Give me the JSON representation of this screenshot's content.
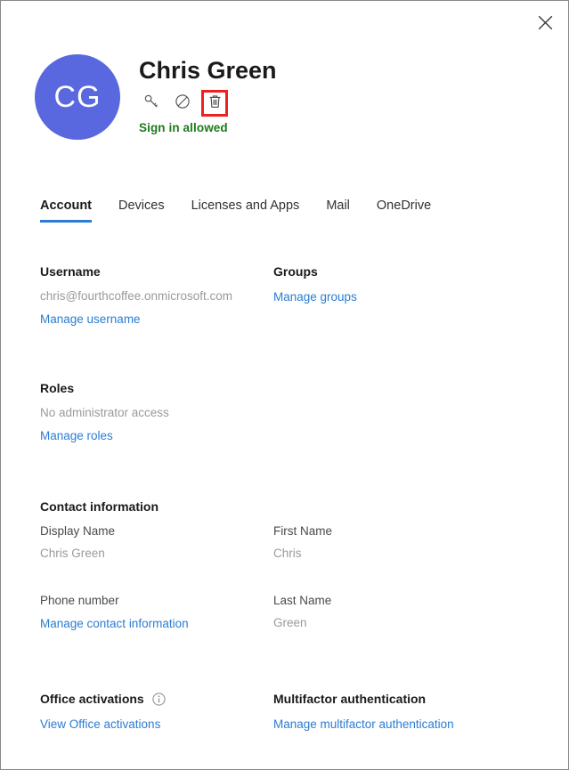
{
  "window": {
    "close_label": "✕"
  },
  "user": {
    "initials": "CG",
    "display_name": "Chris Green",
    "signin_status": "Sign in allowed",
    "avatar_color": "#5a68e0",
    "status_color": "#1d7a1d"
  },
  "actions": [
    {
      "name": "reset-password-icon",
      "label": "key-icon"
    },
    {
      "name": "block-signin-icon",
      "label": "block-icon"
    },
    {
      "name": "delete-user-icon",
      "label": "trash-icon",
      "highlighted": true,
      "highlight_color": "#ef2020"
    }
  ],
  "tabs": [
    {
      "label": "Account",
      "active": true
    },
    {
      "label": "Devices",
      "active": false
    },
    {
      "label": "Licenses and Apps",
      "active": false
    },
    {
      "label": "Mail",
      "active": false
    },
    {
      "label": "OneDrive",
      "active": false
    }
  ],
  "sections": {
    "username": {
      "title": "Username",
      "value": "chris@fourthcoffee.onmicrosoft.com",
      "link": "Manage username"
    },
    "groups": {
      "title": "Groups",
      "link": "Manage groups"
    },
    "roles": {
      "title": "Roles",
      "value": "No administrator access",
      "link": "Manage roles"
    },
    "contact": {
      "title": "Contact information",
      "display_name_label": "Display Name",
      "display_name_value": "Chris Green",
      "first_name_label": "First Name",
      "first_name_value": "Chris",
      "phone_label": "Phone number",
      "last_name_label": "Last Name",
      "last_name_value": "Green",
      "link": "Manage contact information"
    },
    "office_activations": {
      "title": "Office activations",
      "info_icon": "info-icon",
      "link": "View Office activations"
    },
    "mfa": {
      "title": "Multifactor authentication",
      "link": "Manage multifactor authentication"
    }
  },
  "colors": {
    "link": "#2b7cd3",
    "accent": "#2b7cd3",
    "highlight": "#ef2020",
    "success": "#1d7a1d"
  }
}
